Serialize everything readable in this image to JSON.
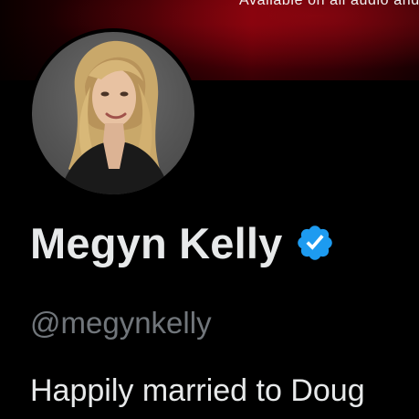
{
  "profile": {
    "banner_text": "Available on all audio and vid",
    "display_name": "Megyn Kelly",
    "handle": "@megynkelly",
    "bio": "Happily married to Doug",
    "verified": true
  },
  "icons": {
    "verified": "verified-badge-icon",
    "avatar": "profile-photo"
  },
  "colors": {
    "background": "#000000",
    "verified_blue": "#1d9bf0",
    "name_text": "#e7e9ea",
    "handle_text": "#71767b"
  }
}
